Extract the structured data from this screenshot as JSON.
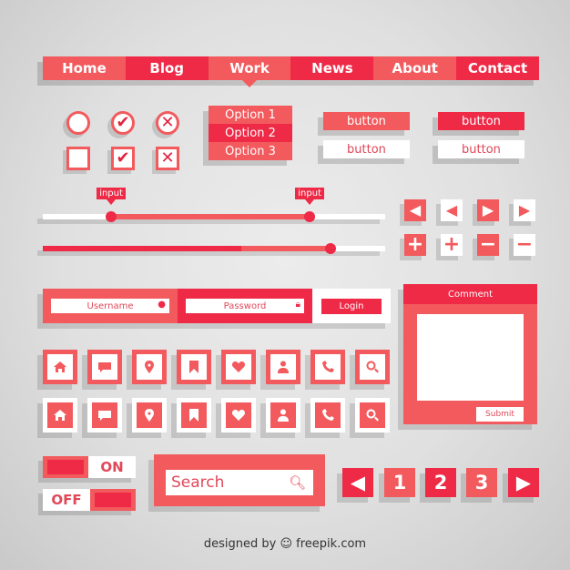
{
  "colors": {
    "primary": "#f25a5d",
    "accent": "#ee2a47",
    "white": "#ffffff",
    "background": "#e0e0e0"
  },
  "nav": {
    "items": [
      {
        "label": "Home"
      },
      {
        "label": "Blog"
      },
      {
        "label": "Work",
        "active": true
      },
      {
        "label": "News"
      },
      {
        "label": "About"
      },
      {
        "label": "Contact"
      }
    ]
  },
  "radios": [
    {
      "state": "empty"
    },
    {
      "state": "checked",
      "icon": "check-icon"
    },
    {
      "state": "crossed",
      "icon": "x-icon"
    }
  ],
  "checkboxes": [
    {
      "state": "empty"
    },
    {
      "state": "checked",
      "icon": "check-icon"
    },
    {
      "state": "crossed",
      "icon": "x-icon"
    }
  ],
  "dropdown": {
    "options": [
      "Option 1",
      "Option 2",
      "Option 3"
    ],
    "selected": "Option 2"
  },
  "buttons": {
    "filled_light": "button",
    "filled_dark": "button",
    "outline_light": "button",
    "outline_dark": "button"
  },
  "range_slider": {
    "low_tooltip": "input",
    "high_tooltip": "input",
    "low_value": 0.2,
    "high_value": 0.78
  },
  "progress_slider": {
    "buffer_value": 0.58,
    "value": 0.84
  },
  "arrow_tiles": [
    "arrow-left-icon",
    "arrow-left-icon",
    "arrow-right-icon",
    "arrow-right-icon"
  ],
  "math_tiles": [
    "plus-icon",
    "plus-icon",
    "minus-icon",
    "minus-icon"
  ],
  "login": {
    "username_placeholder": "Username",
    "password_placeholder": "Password",
    "login_label": "Login"
  },
  "comment": {
    "title": "Comment",
    "submit_label": "Submit"
  },
  "icons": [
    "home-icon",
    "chat-icon",
    "location-pin-icon",
    "bookmark-icon",
    "heart-icon",
    "user-icon",
    "phone-icon",
    "search-icon"
  ],
  "toggles": {
    "on_label": "ON",
    "off_label": "OFF"
  },
  "search": {
    "placeholder": "Search"
  },
  "pagination": {
    "pages": [
      "1",
      "2",
      "3"
    ]
  },
  "credit": "designed by ☺ freepik.com"
}
